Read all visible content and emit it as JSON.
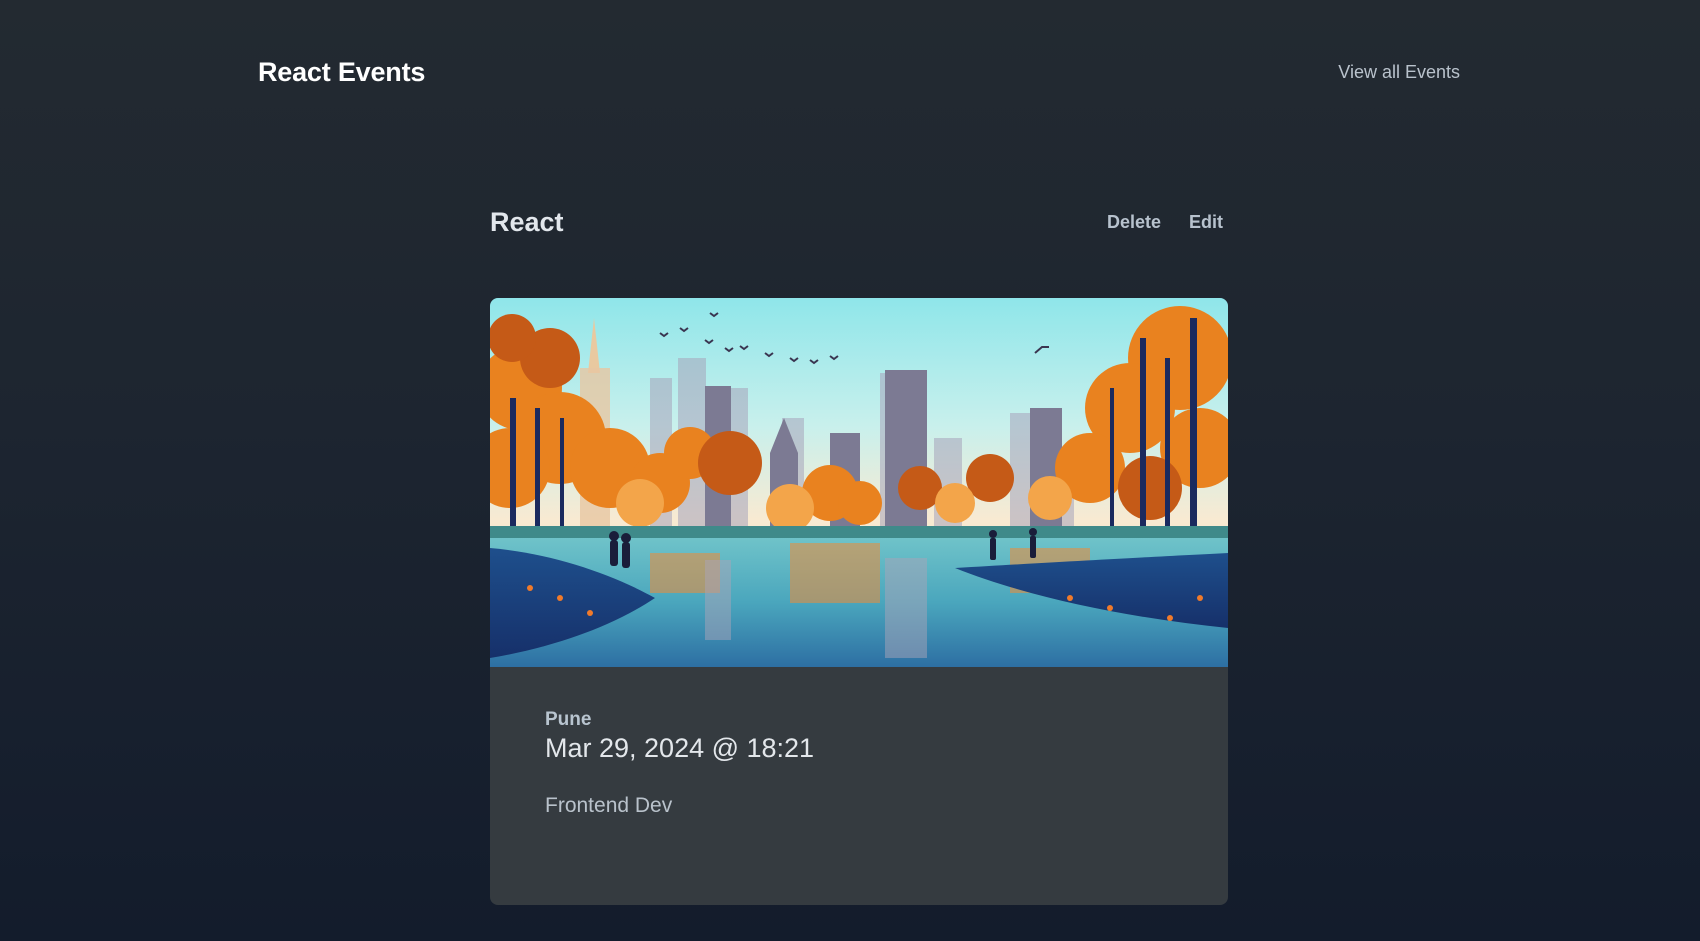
{
  "header": {
    "brand": "React Events",
    "nav_link": "View all Events"
  },
  "event": {
    "title": "React",
    "actions": {
      "delete_label": "Delete",
      "edit_label": "Edit"
    },
    "location": "Pune",
    "datetime": "Mar 29, 2024 @ 18:21",
    "description": "Frontend Dev",
    "image_icon": "autumn-park-city-illustration"
  },
  "colors": {
    "background_top": "#232a31",
    "background_bottom": "#131c2c",
    "card_background": "#353b40",
    "brand_text": "#ffffff",
    "muted_text": "#b9c2cc"
  }
}
